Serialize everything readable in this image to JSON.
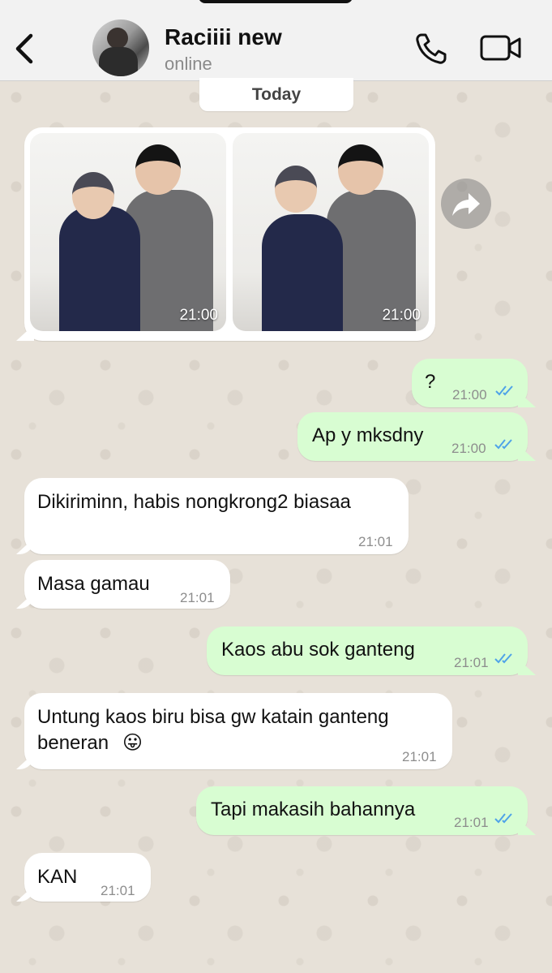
{
  "header": {
    "contact_name": "Raciiii new",
    "status": "online"
  },
  "date_separator": "Today",
  "media": {
    "photos": [
      {
        "time": "21:00"
      },
      {
        "time": "21:00"
      }
    ]
  },
  "messages": [
    {
      "direction": "out",
      "text": "?",
      "time": "21:00",
      "read": true
    },
    {
      "direction": "out",
      "text": "Ap y mksdny",
      "time": "21:00",
      "read": true
    },
    {
      "direction": "in",
      "text": "Dikiriminn, habis nongkrong2 biasaa",
      "time": "21:01"
    },
    {
      "direction": "in",
      "text": "Masa gamau",
      "time": "21:01"
    },
    {
      "direction": "out",
      "text": "Kaos abu sok ganteng",
      "time": "21:01",
      "read": true
    },
    {
      "direction": "in",
      "text_line1": "Untung kaos biru bisa gw katain ganteng",
      "text_line2": "beneran",
      "emoji": "😛",
      "time": "21:01"
    },
    {
      "direction": "out",
      "text": "Tapi makasih bahannya",
      "time": "21:01",
      "read": true
    },
    {
      "direction": "in",
      "text": "KAN",
      "time": "21:01"
    }
  ],
  "colors": {
    "outgoing_bubble": "#d8fdd2",
    "incoming_bubble": "#ffffff",
    "read_ticks": "#4fa3e8",
    "header_bg": "#f2f2f2"
  },
  "icons": {
    "back": "chevron-left-icon",
    "call": "phone-icon",
    "video": "video-camera-icon",
    "forward": "forward-arrow-icon",
    "read": "double-check-icon"
  }
}
